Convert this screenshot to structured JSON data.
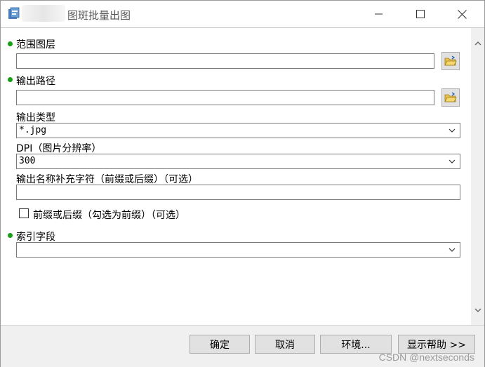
{
  "window": {
    "title": "图斑批量出图"
  },
  "form": {
    "range_layer": {
      "label": "范围图层",
      "value": ""
    },
    "output_path": {
      "label": "输出路径",
      "value": ""
    },
    "output_type": {
      "label": "输出类型",
      "value": "*.jpg"
    },
    "dpi": {
      "label": "DPI（图片分辨率）",
      "value": "300"
    },
    "suffix": {
      "label": "输出名称补充字符（前缀或后缀）（可选）",
      "value": ""
    },
    "prefix_checkbox": {
      "label": "前缀或后缀（勾选为前缀）（可选）",
      "checked": false
    },
    "index_field": {
      "label": "索引字段",
      "value": ""
    }
  },
  "buttons": {
    "ok": "确定",
    "cancel": "取消",
    "env": "环境...",
    "help": "显示帮助 >>"
  },
  "watermark": "CSDN @nextseconds",
  "colors": {
    "required_dot": "#15a015",
    "button_face": "#e1e1e1"
  }
}
